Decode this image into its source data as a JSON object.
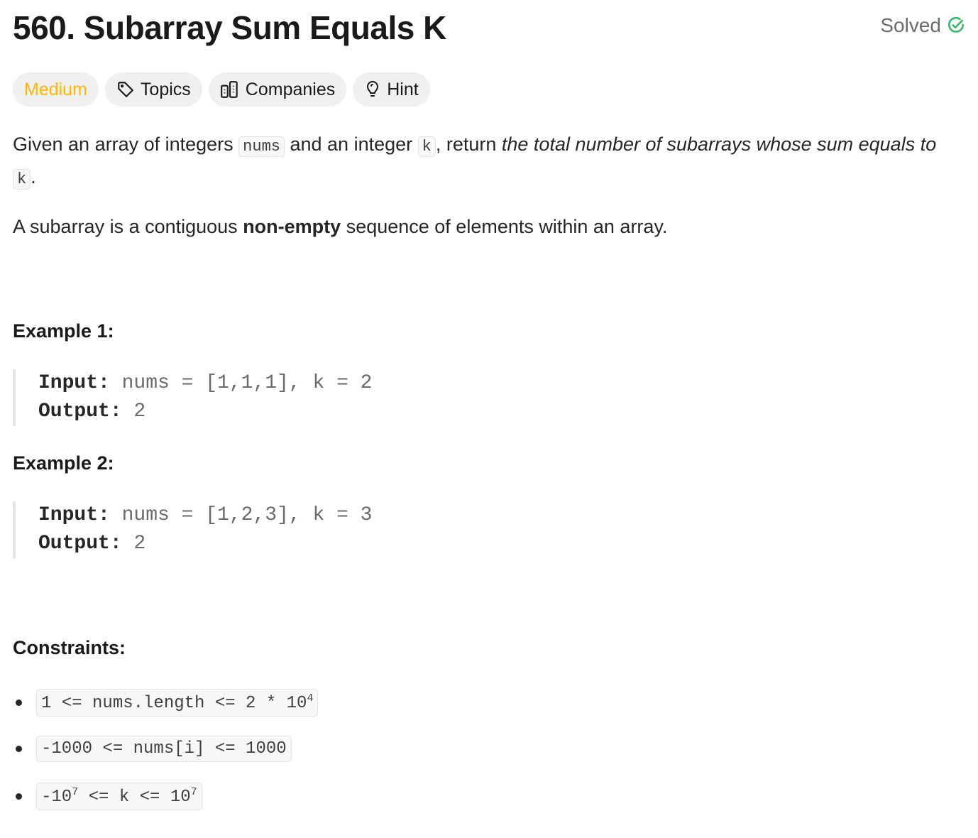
{
  "title": "560. Subarray Sum Equals K",
  "status": "Solved",
  "tags": {
    "difficulty": "Medium",
    "topics": "Topics",
    "companies": "Companies",
    "hint": "Hint"
  },
  "description": {
    "p1_a": "Given an array of integers ",
    "p1_code1": "nums",
    "p1_b": " and an integer ",
    "p1_code2": "k",
    "p1_c": ", return ",
    "p1_em": "the total number of subarrays whose sum equals to",
    "p1_d": " ",
    "p1_code3": "k",
    "p1_e": ".",
    "p2_a": "A subarray is a contiguous ",
    "p2_bold": "non-empty",
    "p2_b": " sequence of elements within an array."
  },
  "examples": [
    {
      "heading": "Example 1:",
      "input_label": "Input:",
      "input": " nums = [1,1,1], k = 2",
      "output_label": "Output:",
      "output": " 2"
    },
    {
      "heading": "Example 2:",
      "input_label": "Input:",
      "input": " nums = [1,2,3], k = 3",
      "output_label": "Output:",
      "output": " 2"
    }
  ],
  "constraints": {
    "heading": "Constraints:",
    "c1": "1 <= nums.length <= 2 * 10",
    "c1_sup": "4",
    "c2": "-1000 <= nums[i] <= 1000",
    "c3_a": "-10",
    "c3_sup1": "7",
    "c3_b": " <= k <= 10",
    "c3_sup2": "7"
  },
  "colors": {
    "medium": "#ffb800",
    "solved": "#2cbb5d"
  }
}
